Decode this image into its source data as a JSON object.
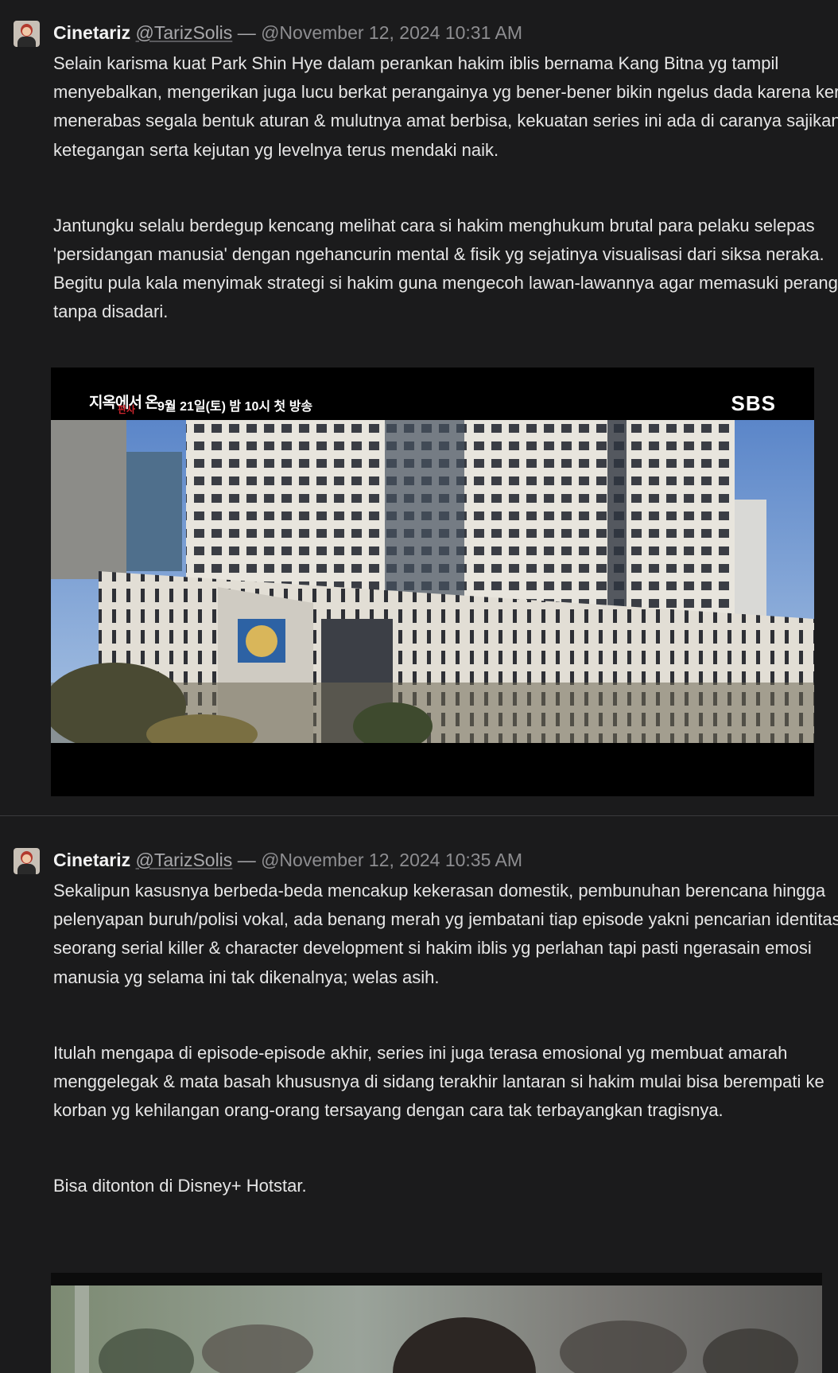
{
  "posts": [
    {
      "author": "Cinetariz",
      "handle": "@TarizSolis",
      "separator": "—",
      "timestamp": "@November 12, 2024 10:31 AM",
      "paragraphs": [
        "Selain karisma kuat Park Shin Hye dalam perankan hakim iblis bernama Kang Bitna yg tampil menyebalkan, mengerikan juga lucu berkat perangainya yg bener-bener bikin ngelus dada karena kerap menerabas segala bentuk aturan & mulutnya amat berbisa, kekuatan series ini ada di caranya sajikan ketegangan serta kejutan yg levelnya terus mendaki naik.",
        "Jantungku selalu berdegup kencang melihat cara si hakim menghukum brutal para pelaku selepas 'persidangan manusia' dengan ngehancurin mental & fisik yg sejatinya visualisasi dari siksa neraka. Begitu pula kala menyimak strategi si hakim guna mengecoh lawan-lawannya agar memasuki perangkap tanpa disadari."
      ],
      "image": {
        "overlay_title": "지옥에서 온",
        "overlay_title2": "판사",
        "overlay_date": "9월 21일(토) 밤 10시 첫 방송",
        "overlay_channel": "SBS"
      }
    },
    {
      "author": "Cinetariz",
      "handle": "@TarizSolis",
      "separator": "—",
      "timestamp": "@November 12, 2024 10:35 AM",
      "paragraphs": [
        "Sekalipun kasusnya berbeda-beda mencakup kekerasan domestik, pembunuhan berencana hingga pelenyapan buruh/polisi vokal, ada benang merah yg jembatani tiap episode yakni pencarian identitas seorang serial killer & character development si hakim iblis yg perlahan tapi pasti ngerasain emosi manusia yg selama ini tak dikenalnya; welas asih.",
        "Itulah mengapa di episode-episode akhir, series ini juga terasa emosional yg membuat amarah menggelegak & mata basah khususnya di sidang terakhir lantaran si hakim mulai bisa berempati ke korban yg kehilangan orang-orang tersayang dengan cara tak terbayangkan tragisnya.",
        "Bisa ditonton di Disney+ Hotstar."
      ]
    }
  ]
}
